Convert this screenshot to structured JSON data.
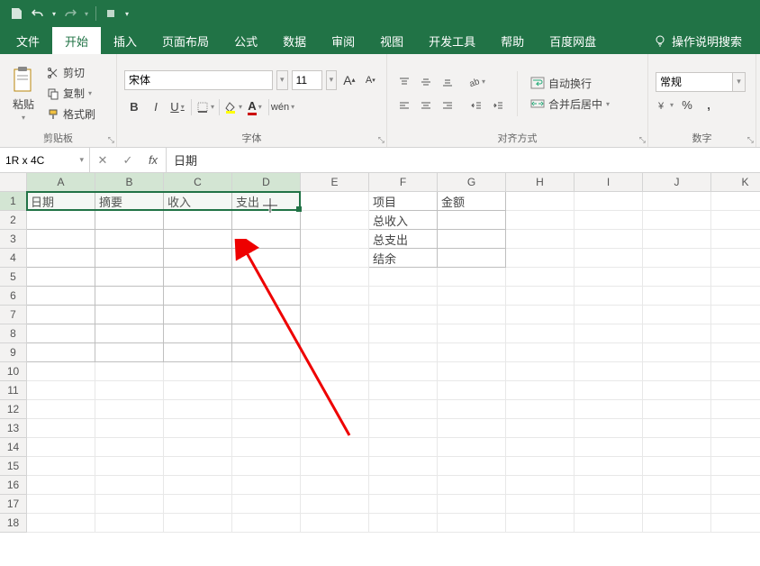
{
  "quickAccess": {
    "save": "save",
    "undo": "undo",
    "redo": "redo"
  },
  "tabs": {
    "file": "文件",
    "home": "开始",
    "insert": "插入",
    "layout": "页面布局",
    "formula": "公式",
    "data": "数据",
    "review": "审阅",
    "view": "视图",
    "dev": "开发工具",
    "help": "帮助",
    "baidu": "百度网盘",
    "search": "操作说明搜索"
  },
  "ribbon": {
    "clipboard": {
      "paste": "粘贴",
      "cut": "剪切",
      "copy": "复制",
      "format": "格式刷",
      "label": "剪贴板"
    },
    "font": {
      "name": "宋体",
      "size": "11",
      "bold": "B",
      "italic": "I",
      "underline": "U",
      "label": "字体"
    },
    "align": {
      "wrap": "自动换行",
      "merge": "合并后居中",
      "label": "对齐方式"
    },
    "number": {
      "format": "常规",
      "label": "数字"
    }
  },
  "nameBox": "1R x 4C",
  "formulaValue": "日期",
  "columns": [
    "A",
    "B",
    "C",
    "D",
    "E",
    "F",
    "G",
    "H",
    "I",
    "J",
    "K"
  ],
  "rows": [
    "1",
    "2",
    "3",
    "4",
    "5",
    "6",
    "7",
    "8",
    "9",
    "10",
    "11",
    "12",
    "13",
    "14",
    "15",
    "16",
    "17",
    "18"
  ],
  "cellsData": {
    "A1": "日期",
    "B1": "摘要",
    "C1": "收入",
    "D1": "支出",
    "F1": "项目",
    "G1": "金额",
    "F2": "总收入",
    "F3": "总支出",
    "F4": "结余"
  },
  "selection": {
    "startCol": 0,
    "endCol": 3,
    "row": 0
  }
}
